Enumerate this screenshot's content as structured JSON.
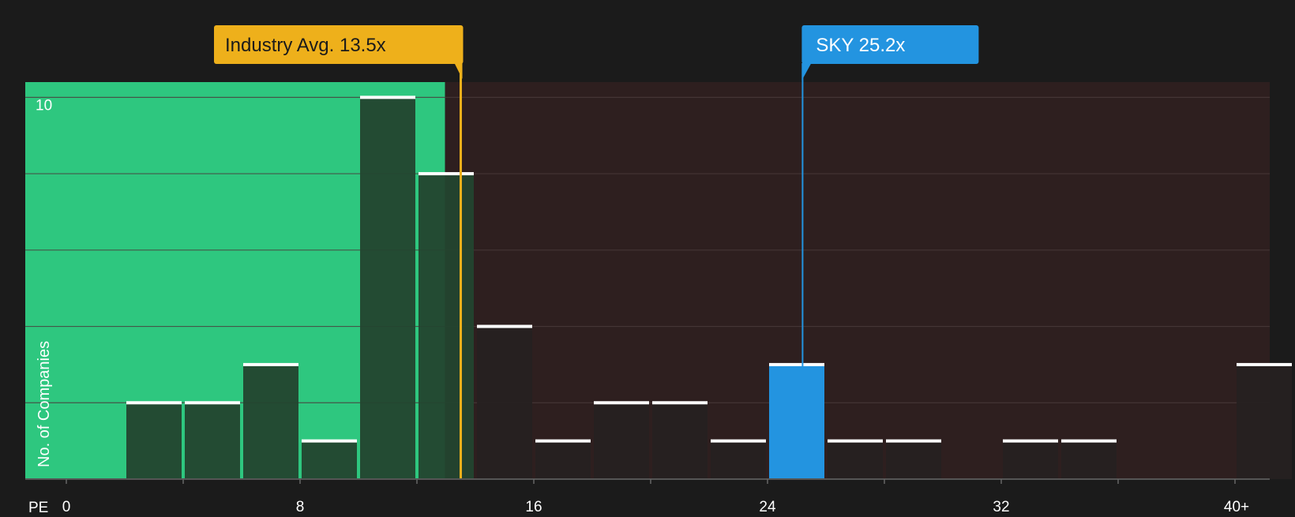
{
  "chart_data": {
    "type": "bar",
    "x_label": "PE",
    "y_label": "No. of Companies",
    "x_ticks": [
      "0",
      "8",
      "16",
      "24",
      "32",
      "40+"
    ],
    "y_ticks": [
      "10"
    ],
    "ylim": [
      0,
      10.4
    ],
    "bins": [
      {
        "x0": 0,
        "x1": 2,
        "value": 0
      },
      {
        "x0": 2,
        "x1": 4,
        "value": 2
      },
      {
        "x0": 4,
        "x1": 6,
        "value": 2
      },
      {
        "x0": 6,
        "x1": 8,
        "value": 3
      },
      {
        "x0": 8,
        "x1": 10,
        "value": 1
      },
      {
        "x0": 10,
        "x1": 12,
        "value": 10
      },
      {
        "x0": 12,
        "x1": 14,
        "value": 8
      },
      {
        "x0": 14,
        "x1": 16,
        "value": 4
      },
      {
        "x0": 16,
        "x1": 18,
        "value": 1
      },
      {
        "x0": 18,
        "x1": 20,
        "value": 2
      },
      {
        "x0": 20,
        "x1": 22,
        "value": 2
      },
      {
        "x0": 22,
        "x1": 24,
        "value": 1
      },
      {
        "x0": 24,
        "x1": 26,
        "value": 3,
        "highlight": true
      },
      {
        "x0": 26,
        "x1": 28,
        "value": 1
      },
      {
        "x0": 28,
        "x1": 30,
        "value": 1
      },
      {
        "x0": 30,
        "x1": 32,
        "value": 0
      },
      {
        "x0": 32,
        "x1": 34,
        "value": 1
      },
      {
        "x0": 34,
        "x1": 36,
        "value": 1
      },
      {
        "x0": 36,
        "x1": 38,
        "value": 0
      },
      {
        "x0": 38,
        "x1": 40,
        "value": 0
      },
      {
        "x0": 40,
        "x1": 42,
        "value": 3
      }
    ],
    "industry_avg": {
      "value": 13.5,
      "label": "Industry Avg. 13.5x"
    },
    "company": {
      "value": 25.2,
      "label": "SKY 25.2x"
    },
    "colors": {
      "background": "#1b1b1b",
      "below_region": "#2ec77f",
      "above_region": "#2e1f1f",
      "bar_dark": "#23452f",
      "bar_plain": "#262121",
      "bar_highlight": "#2394e0",
      "industry_marker": "#eeb01b",
      "company_marker": "#2394e0",
      "grid": "#4a3b3b",
      "text": "#ffffff"
    }
  }
}
